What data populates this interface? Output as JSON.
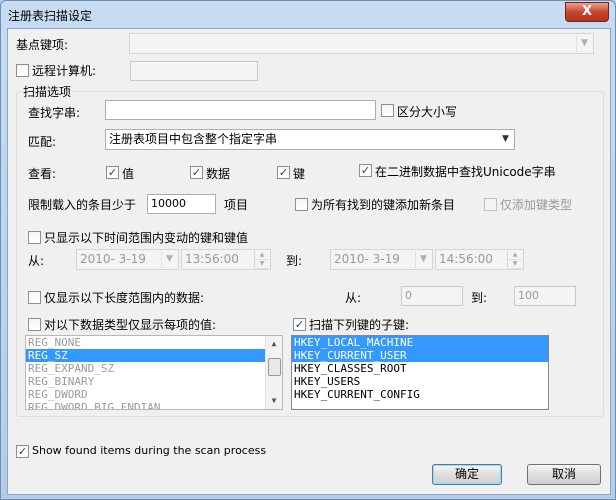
{
  "window": {
    "title": "注册表扫描设定",
    "close_glyph": "X"
  },
  "base_key": {
    "label": "基点键项:",
    "value": ""
  },
  "remote": {
    "label": "远程计算机:",
    "checked": false,
    "value": ""
  },
  "scan_options": {
    "group_title": "扫描选项",
    "find_string": {
      "label": "查找字串:",
      "value": ""
    },
    "case_sensitive": {
      "label": "区分大小写",
      "checked": false
    },
    "match": {
      "label": "匹配:",
      "value": "注册表项目中包含整个指定字串"
    },
    "look_at": {
      "label": "查看:",
      "values": {
        "label": "值",
        "checked": true
      },
      "data": {
        "label": "数据",
        "checked": true
      },
      "keys": {
        "label": "键",
        "checked": true
      },
      "unicode": {
        "label": "在二进制数据中查找Unicode字串",
        "checked": true
      }
    },
    "limit": {
      "label": "限制载入的条目少于",
      "value": "10000",
      "suffix": "项目"
    },
    "add_new_items": {
      "label": "为所有找到的键添加新条目",
      "checked": false
    },
    "add_key_type_only": {
      "label": "仅添加键类型",
      "checked": false
    },
    "time_range": {
      "label": "只显示以下时间范围内变动的键和键值",
      "checked": false,
      "from_label": "从:",
      "from_date": "2010- 3-19",
      "from_time": "13:56:00",
      "to_label": "到:",
      "to_date": "2010- 3-19",
      "to_time": "14:56:00"
    },
    "length_range": {
      "label": "仅显示以下长度范围内的数据:",
      "checked": false,
      "from_label": "从:",
      "from_value": "0",
      "to_label": "到:",
      "to_value": "100"
    },
    "data_types": {
      "label": "对以下数据类型仅显示每项的值:",
      "checked": false,
      "items": [
        "REG_NONE",
        "REG_SZ",
        "REG_EXPAND_SZ",
        "REG_BINARY",
        "REG_DWORD",
        "REG_DWORD_BIG_ENDIAN"
      ],
      "selected_index": 1
    },
    "subkeys": {
      "label": "扫描下列键的子键:",
      "checked": true,
      "items": [
        "HKEY_LOCAL_MACHINE",
        "HKEY_CURRENT_USER",
        "HKEY_CLASSES_ROOT",
        "HKEY_USERS",
        "HKEY_CURRENT_CONFIG"
      ],
      "selected": [
        0,
        1
      ]
    }
  },
  "show_found": {
    "label": "Show found items during the scan process",
    "checked": true
  },
  "buttons": {
    "ok": "确定",
    "cancel": "取消"
  },
  "colors": {
    "selection": "#3399ff",
    "title_bar": "#b9d1ea",
    "close_button": "#c7462d"
  }
}
